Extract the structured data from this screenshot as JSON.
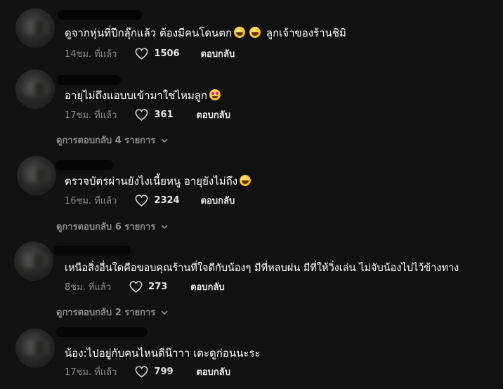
{
  "comments": [
    {
      "text_before": "ดูจากหุ่นที่ปีกลุ๊กแล้ว ต้องมีคนโดนตก",
      "emojis": [
        "grinning-squinting-emoji",
        "grinning-squinting-emoji"
      ],
      "text_after": " ลูกเจ้าของร้านชิมิ",
      "time": "14ชม. ที่แล้ว",
      "likes": "1506",
      "reply_label": "ตอบกลับ"
    },
    {
      "text_before": "อายุไม่ถึงแอบบเข้ามาใช่ไหมลูก",
      "emojis": [
        "heart-eyes-emoji"
      ],
      "text_after": "",
      "time": "17ชม. ที่แล้ว",
      "likes": "361",
      "reply_label": "ตอบกลับ",
      "view_replies": "ดูการตอบกลับ 4 รายการ"
    },
    {
      "text_before": "ตรวจบัตรผ่านยังไงเนี้ยหนู อายุยังไม่ถึง",
      "emojis": [
        "grinning-squinting-emoji"
      ],
      "text_after": "",
      "time": "16ชม. ที่แล้ว",
      "likes": "2324",
      "reply_label": "ตอบกลับ",
      "view_replies": "ดูการตอบกลับ 6 รายการ"
    },
    {
      "text_before": "เหนือสิ่งอื่นใดคือขอบคุณร้านที่ใจดีกับน้องๆ มีที่หลบฝน มีที่ให้วิ่งเล่น ไม่จับน้องไปไว้ข้างทาง",
      "emojis": [],
      "text_after": "",
      "time": "8ชม. ที่แล้ว",
      "likes": "273",
      "reply_label": "ตอบกลับ",
      "view_replies": "ดูการตอบกลับ 2 รายการ"
    },
    {
      "text_before": "น้อง:ไปอยู่กับคนไหนดีน๊าาา เดะดูก่อนนะระ",
      "emojis": [],
      "text_after": "",
      "time": "17ชม. ที่แล้ว",
      "likes": "799",
      "reply_label": "ตอบกลับ"
    }
  ],
  "icons": {
    "like": "heart-outline-icon",
    "expand": "chevron-down-icon"
  },
  "colors": {
    "background": "#111111",
    "text_primary": "#ffffff",
    "text_secondary": "#8a8a8a"
  }
}
